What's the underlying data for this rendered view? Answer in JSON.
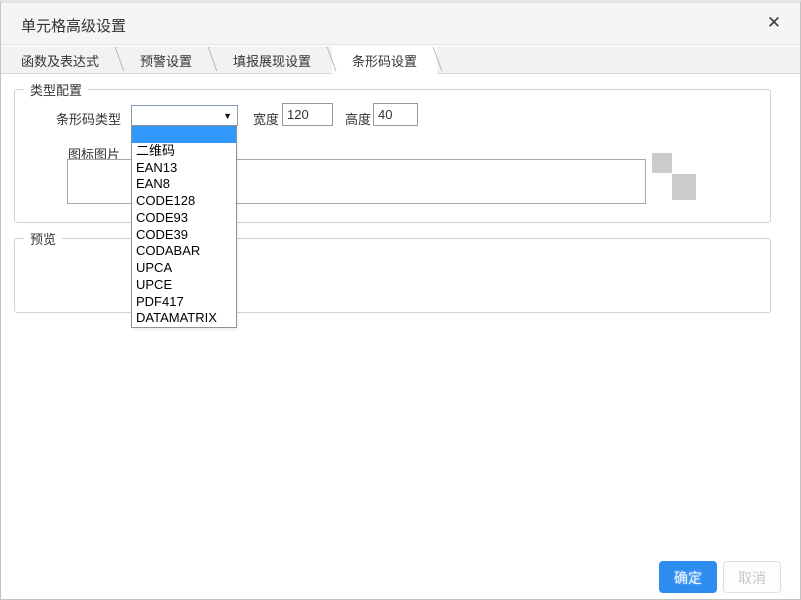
{
  "dialog": {
    "title": "单元格高级设置"
  },
  "icons": {
    "close": "✕",
    "dropdown_arrow": "▼"
  },
  "tabs": [
    {
      "label": "函数及表达式",
      "active": false
    },
    {
      "label": "预警设置",
      "active": false
    },
    {
      "label": "填报展现设置",
      "active": false
    },
    {
      "label": "条形码设置",
      "active": true
    }
  ],
  "type_config": {
    "legend": "类型配置",
    "barcode_type_label": "条形码类型",
    "barcode_type_value": "",
    "width_label": "宽度",
    "width_value": "120",
    "height_label": "高度",
    "height_value": "40",
    "icon_image_label": "图标图片",
    "icon_image_value": ""
  },
  "barcode_dropdown": {
    "highlighted_index": 0,
    "options": [
      "",
      "二维码",
      "EAN13",
      "EAN8",
      "CODE128",
      "CODE93",
      "CODE39",
      "CODABAR",
      "UPCA",
      "UPCE",
      "PDF417",
      "DATAMATRIX"
    ]
  },
  "preview": {
    "legend": "预览"
  },
  "buttons": {
    "ok": "确定",
    "cancel": "取消"
  },
  "colors": {
    "accent_blue": "#2d8cf0",
    "highlight_blue": "#3297fd",
    "checker_gray": "#cbcbcb",
    "titlebar_bg": "#f5f5f5",
    "tabbar_bg": "#f2f2f2"
  }
}
